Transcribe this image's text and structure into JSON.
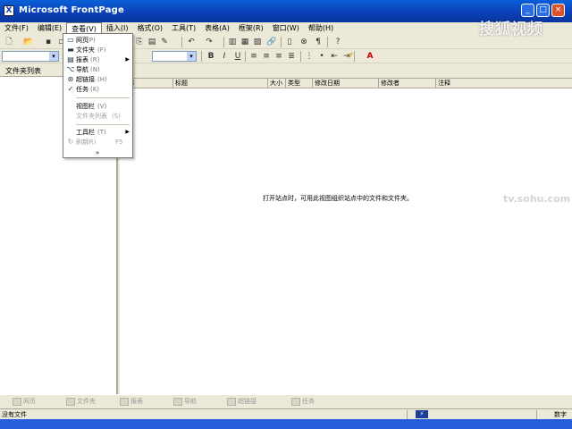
{
  "window": {
    "title": "Microsoft FrontPage",
    "app_icon": "X"
  },
  "menubar": [
    "文件(F)",
    "编辑(E)",
    "查看(V)",
    "插入(I)",
    "格式(O)",
    "工具(T)",
    "表格(A)",
    "框架(R)",
    "窗口(W)",
    "帮助(H)"
  ],
  "view_menu": {
    "items": [
      {
        "label": "网页",
        "shortcut": "(P)",
        "icon": "page-icon"
      },
      {
        "label": "文件夹",
        "shortcut": "(F)",
        "icon": "folder-icon"
      },
      {
        "label": "报表",
        "shortcut": "(R)",
        "icon": "reports-icon",
        "submenu": true
      },
      {
        "label": "导航",
        "shortcut": "(N)",
        "icon": "navigation-icon"
      },
      {
        "label": "超链接",
        "shortcut": "(H)",
        "icon": "hyperlink-icon"
      },
      {
        "label": "任务",
        "shortcut": "(K)",
        "icon": "tasks-icon"
      },
      {
        "label": "视图栏",
        "shortcut": "(V)"
      },
      {
        "label": "文件夹列表",
        "shortcut": "(S)",
        "disabled": true
      },
      {
        "label": "工具栏",
        "shortcut": "(T)",
        "submenu": true
      },
      {
        "label": "刷新",
        "shortcut": "(R)",
        "hotkey": "F5",
        "disabled": true,
        "icon": "refresh-icon"
      }
    ],
    "more": "»"
  },
  "folder_panel": {
    "header": "文件夹列表"
  },
  "content": {
    "columns": [
      "名称",
      "标题",
      "大小",
      "类型",
      "修改日期",
      "修改者",
      "注释"
    ],
    "empty_message": "打开站点时，可用此视图组织站点中的文件和文件夹。"
  },
  "views_bar": [
    "网页",
    "文件夹",
    "报表",
    "导航",
    "超链接",
    "任务"
  ],
  "status": {
    "left": "没有文件",
    "right": "数字"
  },
  "watermark": {
    "brand": "搜狐视频",
    "url": "tv.sohu.com"
  }
}
